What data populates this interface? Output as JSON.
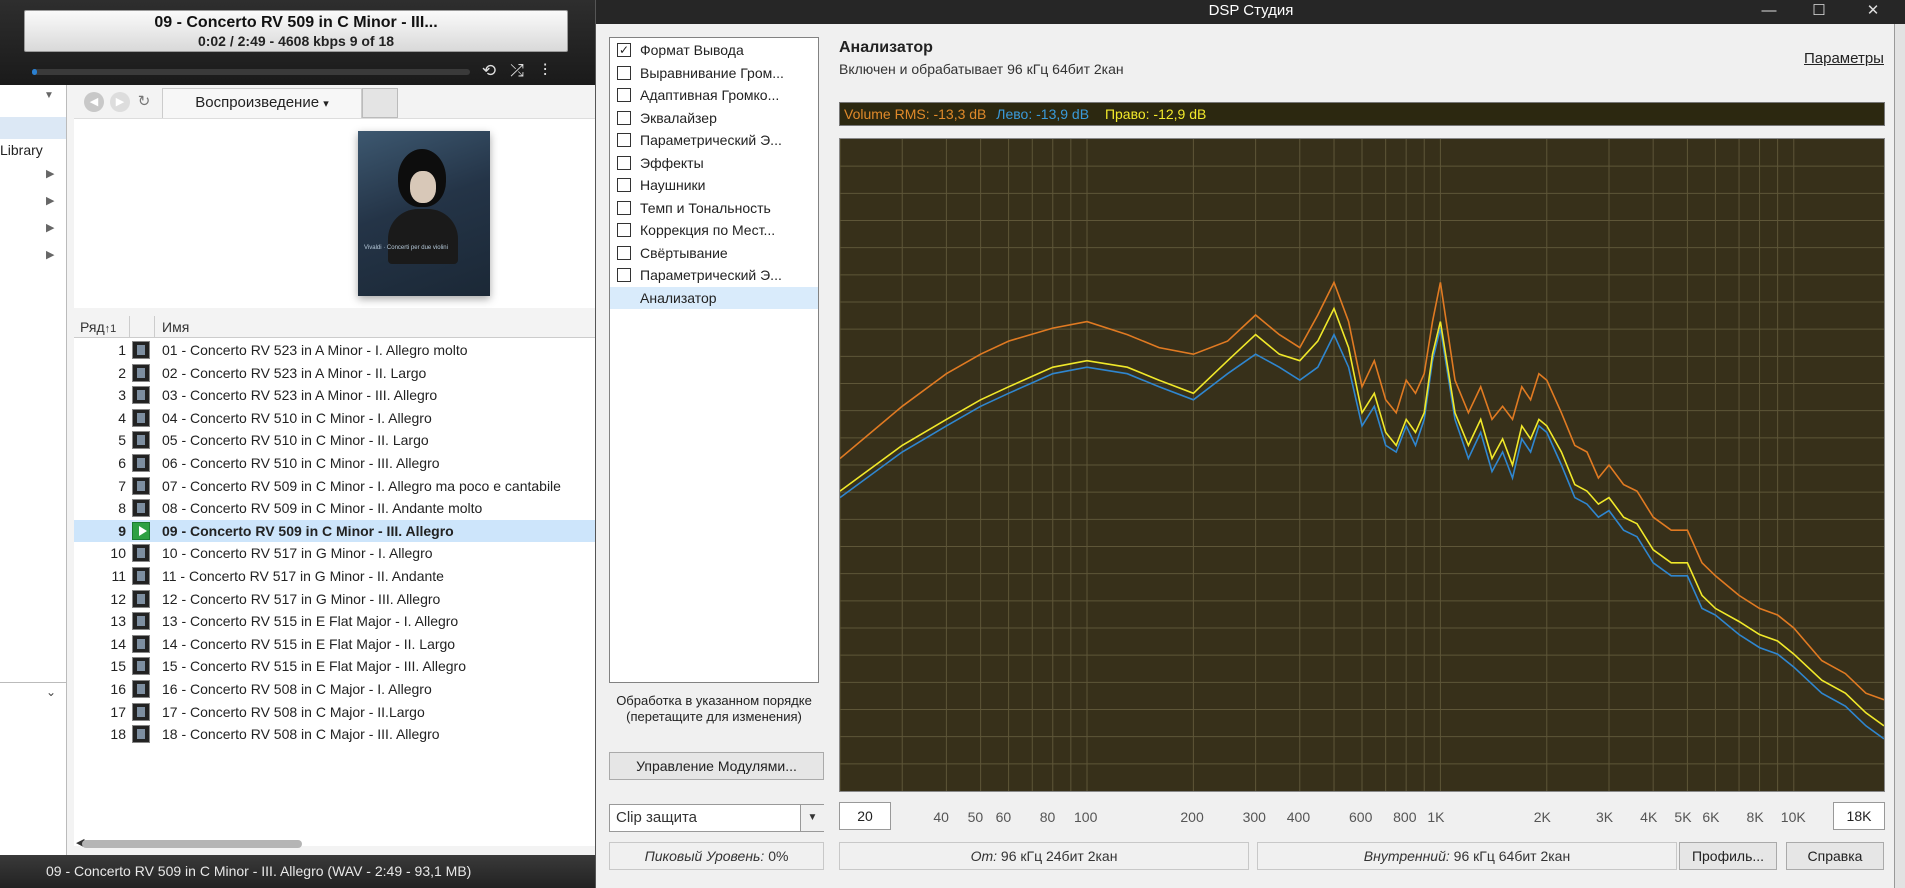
{
  "player": {
    "now_title": "09 - Concerto RV 509 in C Minor - III...",
    "now_info": "0:02 / 2:49 - 4608 kbps  9 of 18",
    "progress": 0.012,
    "library_label": "Library",
    "tab_label": "Воспроизведение",
    "tab_arrow": "▾",
    "col_rank": "Ряд",
    "col_rank_sort": "↑1",
    "col_name": "Имя",
    "tracks": [
      {
        "n": "1",
        "name": "01 - Concerto RV 523 in A Minor - I. Allegro molto"
      },
      {
        "n": "2",
        "name": "02 - Concerto RV 523 in A Minor - II. Largo"
      },
      {
        "n": "3",
        "name": "03 - Concerto RV 523 in A Minor - III. Allegro"
      },
      {
        "n": "4",
        "name": "04 - Concerto RV 510 in C Minor - I. Allegro"
      },
      {
        "n": "5",
        "name": "05 - Concerto RV 510 in C Minor - II. Largo"
      },
      {
        "n": "6",
        "name": "06 - Concerto RV 510 in C Minor - III. Allegro"
      },
      {
        "n": "7",
        "name": "07 - Concerto RV 509 in C Minor - I. Allegro ma poco e cantabile"
      },
      {
        "n": "8",
        "name": "08 - Concerto RV 509 in C Minor - II. Andante molto"
      },
      {
        "n": "9",
        "name": "09 - Concerto RV 509 in C Minor - III. Allegro"
      },
      {
        "n": "10",
        "name": "10 - Concerto RV 517 in G Minor - I. Allegro"
      },
      {
        "n": "11",
        "name": "11 - Concerto RV 517 in G Minor - II. Andante"
      },
      {
        "n": "12",
        "name": "12 - Concerto RV 517 in G Minor - III. Allegro"
      },
      {
        "n": "13",
        "name": "13 - Concerto RV 515 in E Flat Major - I. Allegro"
      },
      {
        "n": "14",
        "name": "14 - Concerto RV 515 in E Flat Major - II. Largo"
      },
      {
        "n": "15",
        "name": "15 - Concerto RV 515 in E Flat Major - III. Allegro"
      },
      {
        "n": "16",
        "name": "16 - Concerto RV 508 in C Major - I. Allegro"
      },
      {
        "n": "17",
        "name": "17 - Concerto RV 508 in C Major - II.Largo"
      },
      {
        "n": "18",
        "name": "18 - Concerto RV 508 in C Major - III. Allegro"
      }
    ],
    "active_track": 9,
    "status": "09 - Concerto RV 509 in C Minor - III. Allegro (WAV - 2:49 - 93,1 MB)"
  },
  "dsp": {
    "title": "DSP Студия",
    "win_min": "—",
    "win_max": "☐",
    "win_close": "✕",
    "modules": [
      {
        "label": "Формат Вывода",
        "checked": true
      },
      {
        "label": "Выравнивание Гром...",
        "checked": false
      },
      {
        "label": "Адаптивная Громко...",
        "checked": false
      },
      {
        "label": "Эквалайзер",
        "checked": false
      },
      {
        "label": "Параметрический Э...",
        "checked": false
      },
      {
        "label": "Эффекты",
        "checked": false
      },
      {
        "label": "Наушники",
        "checked": false
      },
      {
        "label": "Темп и Тональность",
        "checked": false
      },
      {
        "label": "Коррекция по Мест...",
        "checked": false
      },
      {
        "label": "Свёртывание",
        "checked": false
      },
      {
        "label": "Параметрический Э...",
        "checked": false
      },
      {
        "label": "Анализатор",
        "checked": null
      }
    ],
    "order_note": "Обработка в указанном порядке (перетащите для изменения)",
    "manage_button": "Управление Модулями...",
    "analyzer_title": "Анализатор",
    "analyzer_sub": "Включен и обрабатывает 96 кГц 64бит 2кан",
    "params_link": "Параметры",
    "vu_rms": "Volume RMS: -13,3 dB",
    "vu_left": "Лево: -13,9 dB",
    "vu_right": "Право: -12,9 dB",
    "freq_from": "20",
    "freq_to": "18K",
    "freq_ticks": [
      "40",
      "50",
      "60",
      "80",
      "100",
      "200",
      "300",
      "400",
      "600",
      "800",
      "1K",
      "2K",
      "3K",
      "4K",
      "5K",
      "6K",
      "8K",
      "10K"
    ],
    "clip_label": "Clip защита",
    "peak_label": "Пиковый Уровень:",
    "peak_value": "0%",
    "from_label": "От:",
    "from_value": "96 кГц 24бит 2кан",
    "internal_label": "Внутренний:",
    "internal_value": "96 кГц 64бит 2кан",
    "profile_button": "Профиль...",
    "help_button": "Справка",
    "colors": {
      "rms": "#e07a22",
      "left": "#2f86cf",
      "right": "#f0e82a",
      "graph_bg": "#37301a",
      "grid": "#5e5638"
    }
  },
  "chart_data": {
    "type": "line",
    "xscale": "log",
    "xlim": [
      20,
      18000
    ],
    "x": [
      20,
      30,
      40,
      50,
      60,
      80,
      100,
      130,
      160,
      200,
      250,
      300,
      350,
      400,
      450,
      500,
      550,
      600,
      650,
      700,
      750,
      800,
      850,
      900,
      950,
      1000,
      1100,
      1200,
      1300,
      1400,
      1500,
      1600,
      1700,
      1800,
      1900,
      2000,
      2200,
      2400,
      2600,
      2800,
      3000,
      3300,
      3600,
      4000,
      4500,
      5000,
      5500,
      6000,
      7000,
      8000,
      9000,
      10000,
      12000,
      14000,
      16000,
      18000
    ],
    "series": [
      {
        "name": "Volume RMS",
        "values": [
          0.51,
          0.59,
          0.64,
          0.67,
          0.69,
          0.71,
          0.72,
          0.7,
          0.68,
          0.67,
          0.69,
          0.73,
          0.7,
          0.68,
          0.73,
          0.78,
          0.72,
          0.62,
          0.66,
          0.6,
          0.58,
          0.63,
          0.61,
          0.64,
          0.72,
          0.78,
          0.63,
          0.58,
          0.62,
          0.57,
          0.59,
          0.57,
          0.62,
          0.6,
          0.64,
          0.63,
          0.58,
          0.53,
          0.52,
          0.48,
          0.5,
          0.47,
          0.46,
          0.42,
          0.4,
          0.4,
          0.35,
          0.33,
          0.3,
          0.28,
          0.27,
          0.25,
          0.2,
          0.18,
          0.15,
          0.14
        ]
      },
      {
        "name": "Лево",
        "values": [
          0.45,
          0.52,
          0.56,
          0.59,
          0.61,
          0.64,
          0.65,
          0.64,
          0.62,
          0.6,
          0.64,
          0.67,
          0.65,
          0.63,
          0.65,
          0.7,
          0.65,
          0.56,
          0.59,
          0.53,
          0.52,
          0.56,
          0.53,
          0.57,
          0.66,
          0.71,
          0.57,
          0.51,
          0.55,
          0.49,
          0.52,
          0.48,
          0.54,
          0.52,
          0.56,
          0.55,
          0.5,
          0.45,
          0.44,
          0.42,
          0.43,
          0.4,
          0.39,
          0.35,
          0.33,
          0.33,
          0.28,
          0.27,
          0.24,
          0.22,
          0.21,
          0.19,
          0.15,
          0.13,
          0.1,
          0.08
        ]
      },
      {
        "name": "Право",
        "values": [
          0.46,
          0.53,
          0.57,
          0.6,
          0.62,
          0.65,
          0.66,
          0.65,
          0.63,
          0.61,
          0.66,
          0.7,
          0.67,
          0.66,
          0.69,
          0.74,
          0.68,
          0.58,
          0.61,
          0.55,
          0.53,
          0.57,
          0.55,
          0.58,
          0.67,
          0.72,
          0.58,
          0.53,
          0.57,
          0.51,
          0.54,
          0.5,
          0.56,
          0.54,
          0.57,
          0.56,
          0.52,
          0.47,
          0.46,
          0.44,
          0.45,
          0.42,
          0.41,
          0.37,
          0.35,
          0.35,
          0.3,
          0.28,
          0.26,
          0.24,
          0.23,
          0.21,
          0.17,
          0.15,
          0.12,
          0.1
        ]
      }
    ],
    "ylim": [
      0,
      1
    ],
    "grid": true
  }
}
